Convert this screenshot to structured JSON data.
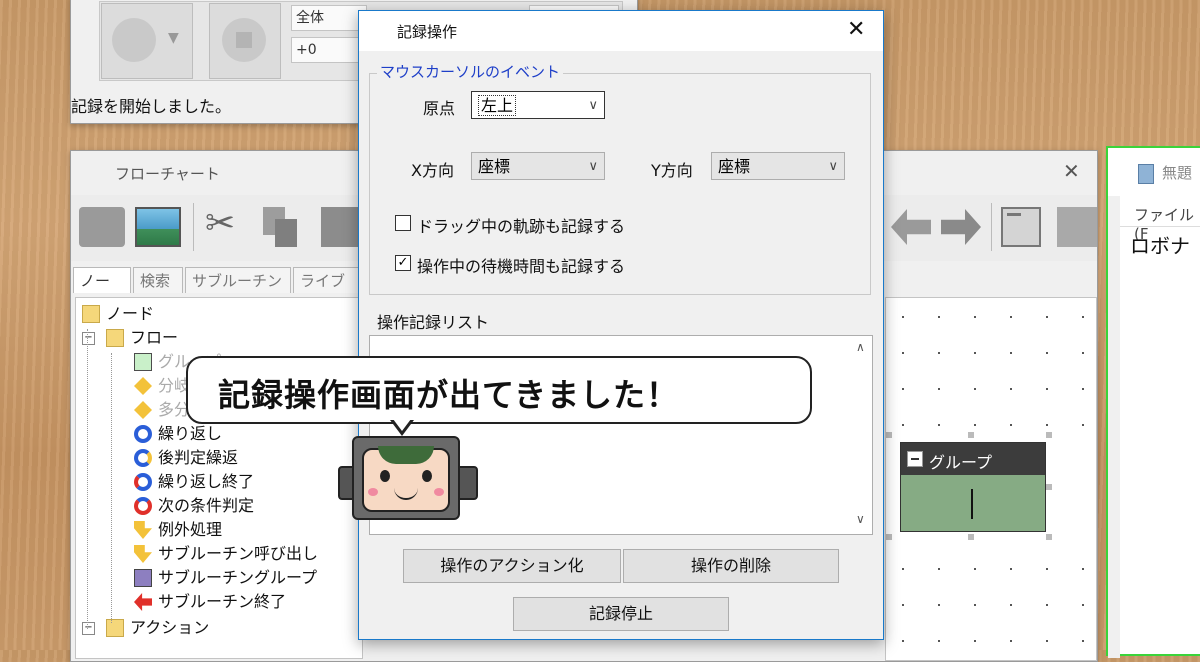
{
  "top_window": {
    "dropdown_value": "全体",
    "offset_value": "+0",
    "status_text": "記録を開始しました。"
  },
  "flowchart": {
    "title": "フローチャート",
    "close": "✕",
    "tabs": [
      "ノード",
      "検索",
      "サブルーチン",
      "ライブラリ"
    ],
    "tree": [
      {
        "label": "ノード",
        "icon": "folder-icon",
        "level": 0
      },
      {
        "label": "フロー",
        "icon": "folder-icon",
        "level": 1,
        "expander": "−"
      },
      {
        "label": "グループ",
        "icon": "group-icon",
        "level": 2
      },
      {
        "label": "分岐",
        "icon": "branch-icon",
        "level": 2
      },
      {
        "label": "多分岐",
        "icon": "multi-branch-icon",
        "level": 2
      },
      {
        "label": "繰り返し",
        "icon": "loop-icon",
        "level": 2
      },
      {
        "label": "後判定繰返",
        "icon": "post-check-loop-icon",
        "level": 2
      },
      {
        "label": "繰り返し終了",
        "icon": "loop-end-icon",
        "level": 2
      },
      {
        "label": "次の条件判定",
        "icon": "next-condition-icon",
        "level": 2
      },
      {
        "label": "例外処理",
        "icon": "exception-icon",
        "level": 2
      },
      {
        "label": "サブルーチン呼び出し",
        "icon": "subroutine-call-icon",
        "level": 2
      },
      {
        "label": "サブルーチングループ",
        "icon": "subroutine-group-icon",
        "level": 2
      },
      {
        "label": "サブルーチン終了",
        "icon": "subroutine-end-icon",
        "level": 2
      },
      {
        "label": "アクション",
        "icon": "folder-icon",
        "level": 1,
        "expander": "−"
      }
    ],
    "group_node_label": "グループ"
  },
  "right_window": {
    "title": "無題",
    "menu": "ファイル(F",
    "content": "ロボナ"
  },
  "dialog": {
    "title": "記録操作",
    "close": "✕",
    "group_title": "マウスカーソルのイベント",
    "origin_label": "原点",
    "origin_value": "左上",
    "x_label": "X方向",
    "x_value": "座標",
    "y_label": "Y方向",
    "y_value": "座標",
    "drag_label": "ドラッグ中の軌跡も記録する",
    "drag_checked": false,
    "wait_label": "操作中の待機時間も記録する",
    "wait_checked": true,
    "list_label": "操作記録リスト",
    "to_action_button": "操作のアクション化",
    "delete_button": "操作の削除",
    "stop_button": "記録停止"
  },
  "callout": {
    "text": "記録操作画面が出てきました！"
  },
  "colors": {
    "accent_title": "#1e3fc8",
    "group_node_fill": "#86ab84",
    "group_node_header": "#3c3c3c",
    "highlight_border": "#3ad43a"
  }
}
